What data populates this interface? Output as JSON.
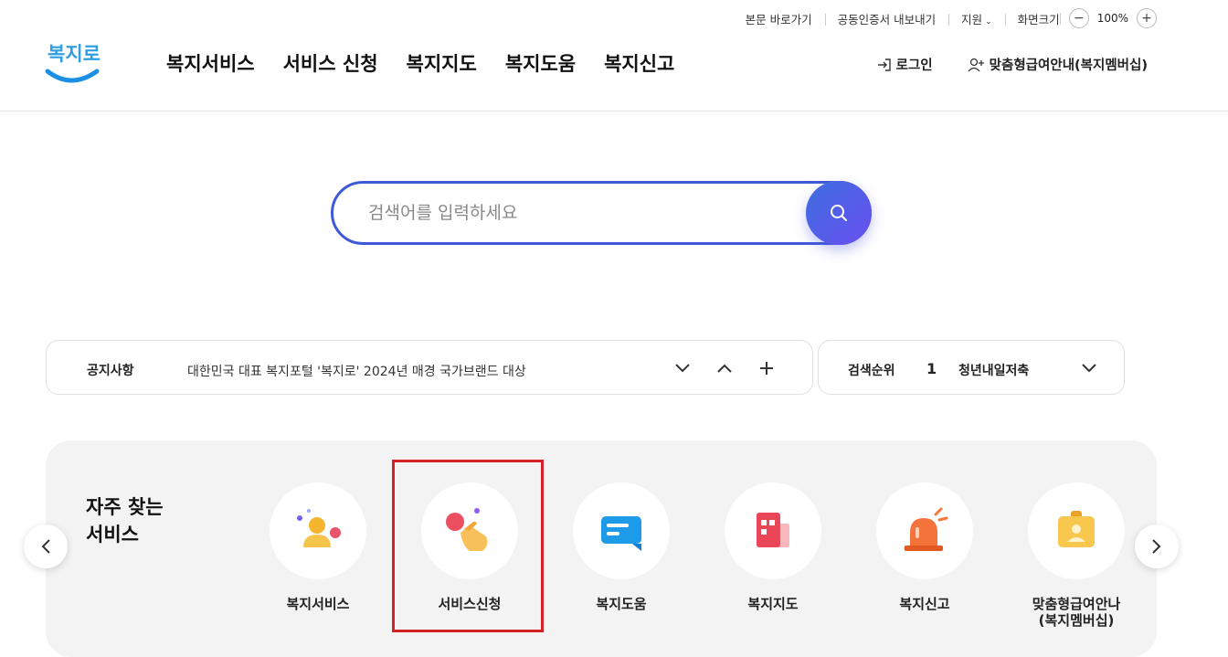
{
  "utility": {
    "skip_to_content": "본문 바로가기",
    "cert_export": "공동인증서 내보내기",
    "support": "지원",
    "screen_size_label": "화면크기",
    "zoom_minus": "−",
    "zoom_value": "100%",
    "zoom_plus": "+"
  },
  "logo": {
    "text": "복지로"
  },
  "nav": {
    "items": [
      "복지서비스",
      "서비스 신청",
      "복지지도",
      "복지도움",
      "복지신고"
    ]
  },
  "header_right": {
    "login": "로그인",
    "membership": "맞춤형급여안내(복지멤버십)"
  },
  "search": {
    "placeholder": "검색어를 입력하세요"
  },
  "notice": {
    "label": "공지사항",
    "text": "대한민국 대표 복지포털 '복지로' 2024년 매경 국가브랜드 대상"
  },
  "ranking": {
    "label": "검색순위",
    "number": "1",
    "keyword": "청년내일저축"
  },
  "frequent": {
    "title_line1": "자주 찾는",
    "title_line2": "서비스",
    "items": [
      {
        "name": "복지서비스",
        "icon": "people-icon"
      },
      {
        "name": "서비스신청",
        "icon": "hand-tap-icon"
      },
      {
        "name": "복지도움",
        "icon": "chat-icon"
      },
      {
        "name": "복지지도",
        "icon": "map-icon"
      },
      {
        "name": "복지신고",
        "icon": "siren-icon"
      },
      {
        "name_line1": "맞춤형급여안나",
        "name_line2": "(복지멤버십)",
        "icon": "id-card-icon"
      }
    ]
  },
  "colors": {
    "accent": "#3f5ad8",
    "highlight": "#d42027",
    "panel_bg": "#f3f3f3"
  }
}
